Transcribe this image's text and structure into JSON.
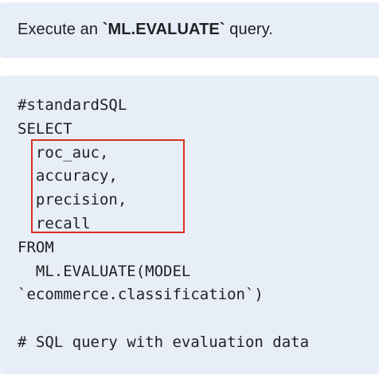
{
  "instruction": {
    "prefix": "Execute an ",
    "keyword": "`ML.EVALUATE`",
    "suffix": " query."
  },
  "code": {
    "lines": [
      "#standardSQL",
      "SELECT",
      "  roc_auc,",
      "  accuracy,",
      "  precision,",
      "  recall",
      "FROM",
      "  ML.EVALUATE(MODEL",
      "`ecommerce.classification`)",
      "",
      "# SQL query with evaluation data"
    ]
  },
  "colors": {
    "panel_background": "#e8eef7",
    "highlight_border": "#d93025",
    "text": "#202124"
  }
}
